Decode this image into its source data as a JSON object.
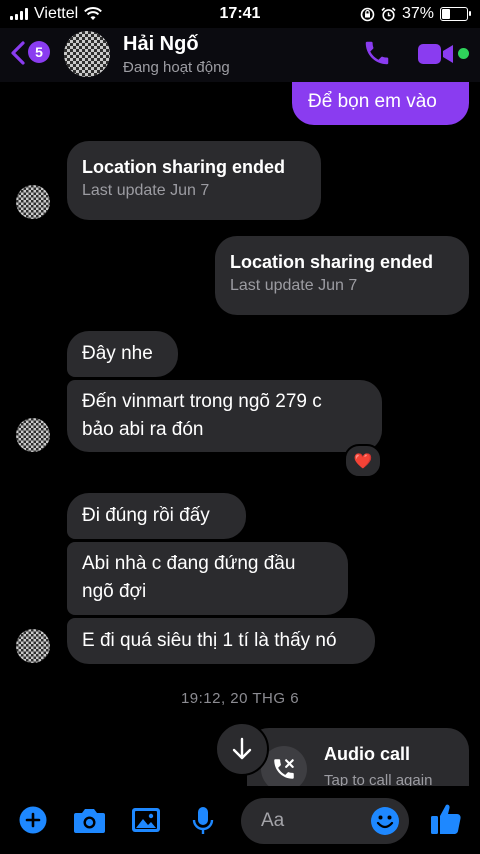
{
  "status_bar": {
    "carrier": "Viettel",
    "time": "17:41",
    "battery_percent": "37%",
    "battery_level": 0.37
  },
  "header": {
    "back_badge_count": "5",
    "contact_name": "Hải Ngố",
    "contact_status": "Đang hoạt động",
    "icons": [
      "chevron-left-icon",
      "phone-icon",
      "video-camera-icon"
    ]
  },
  "messages": {
    "sent_1": "Để bọn em vào",
    "location_received": {
      "title": "Location sharing ended",
      "subtitle": "Last update Jun 7"
    },
    "location_sent": {
      "title": "Location sharing ended",
      "subtitle": "Last update Jun 7"
    },
    "received_1": "Đây nhe",
    "received_2_line1": "Đến vinmart trong ngõ 279 c",
    "received_2_line2": "bảo abi ra đón",
    "reaction": "❤️",
    "received_3": "Đi đúng rồi đấy",
    "received_4_line1": "Abi nhà c đang đứng đầu",
    "received_4_line2": "ngõ đợi",
    "received_5": "E đi quá siêu thị 1 tí là thấy nó",
    "timestamp": "19:12, 20 THG 6",
    "audio_call": {
      "title": "Audio call",
      "subtitle": "Tap to call again"
    }
  },
  "composer": {
    "placeholder": "Aa",
    "icons": [
      "plus-icon",
      "camera-icon",
      "image-icon",
      "microphone-icon",
      "emoji-icon",
      "thumbs-up-icon"
    ]
  },
  "colors": {
    "accent": "#8a3cf0",
    "accent_blue": "#1e88ff",
    "bubble_received": "#2b2b2e",
    "online": "#2fd35b"
  }
}
